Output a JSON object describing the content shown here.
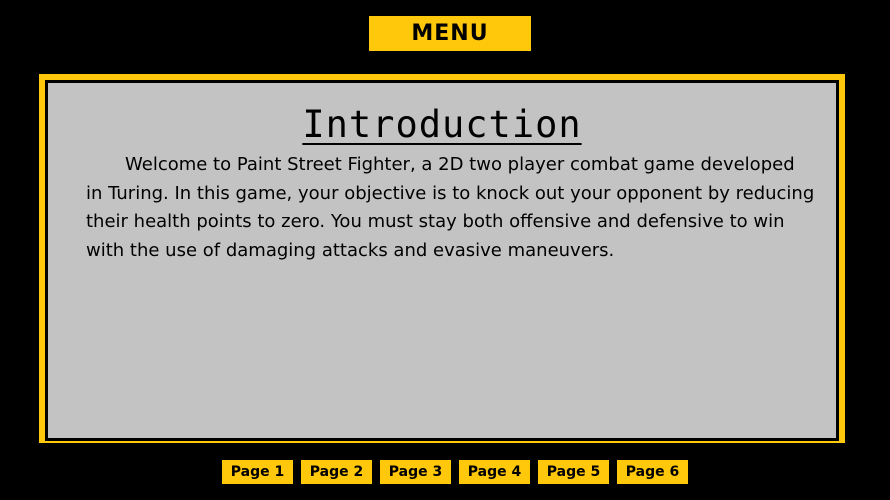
{
  "menu": {
    "label": "MENU"
  },
  "content": {
    "title": "Introduction",
    "body": "Welcome to Paint Street Fighter, a 2D two player combat game developed in Turing. In this game, your objective is to knock out your opponent by reducing their health points to zero. You must stay both offensive and defensive to win with the use of damaging attacks and evasive maneuvers."
  },
  "pages": [
    {
      "label": "Page 1"
    },
    {
      "label": "Page 2"
    },
    {
      "label": "Page 3"
    },
    {
      "label": "Page 4"
    },
    {
      "label": "Page 5"
    },
    {
      "label": "Page 6"
    }
  ],
  "colors": {
    "background": "#000000",
    "accent": "#ffc80a",
    "panel": "#c3c3c3",
    "text": "#000000"
  }
}
